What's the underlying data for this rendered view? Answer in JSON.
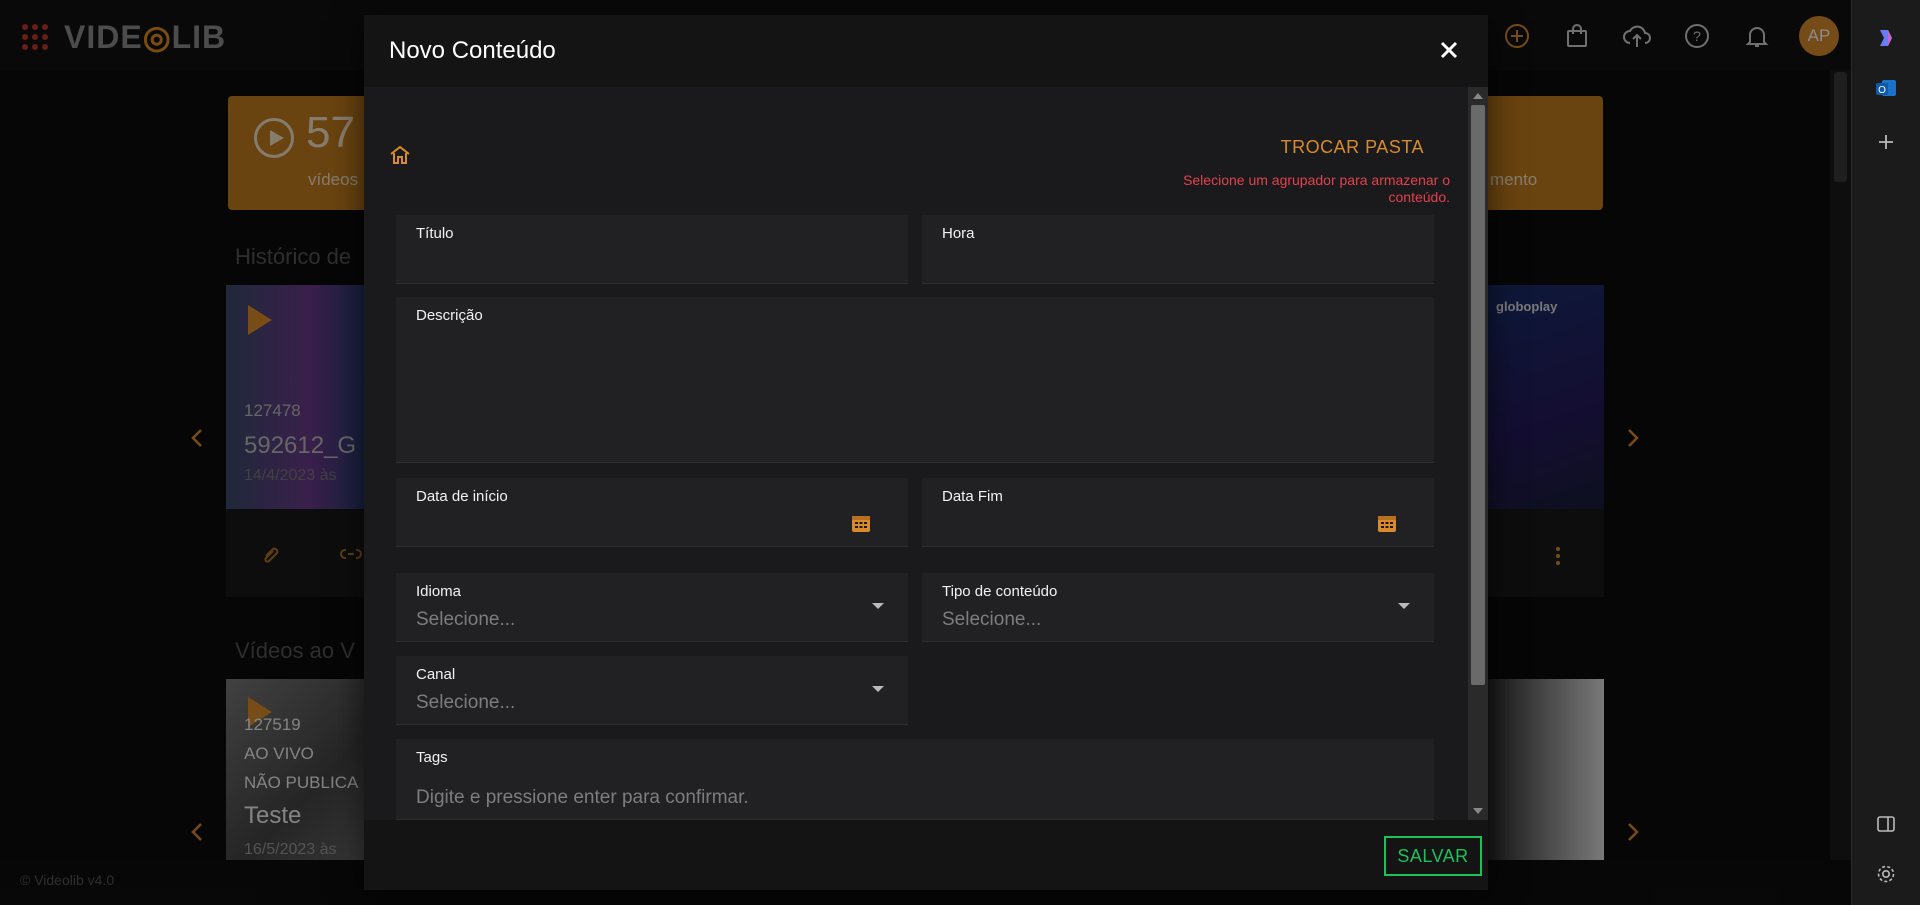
{
  "app": {
    "brand_left": "VIDE",
    "brand_right": "LIB",
    "avatar_initials": "AP",
    "footer_text": "© Videolib v4.0"
  },
  "background": {
    "stat_left": {
      "value": "57",
      "label": "vídeos"
    },
    "stat_right": {
      "label": "mento"
    },
    "section_history": "Histórico de",
    "section_live": "Vídeos ao V",
    "card1": {
      "id": "127478",
      "title": "592612_G",
      "date": "14/4/2023 às"
    },
    "card2": {
      "id": "127519",
      "line2": "AO VIVO",
      "line3": "NÃO PUBLICA",
      "title": "Teste",
      "date": "16/5/2023 às"
    },
    "card_right_brand": "globoplay"
  },
  "modal": {
    "title": "Novo Conteúdo",
    "change_folder": "TROCAR PASTA",
    "hint": "Selecione um agrupador para armazenar o conteúdo.",
    "save": "SALVAR",
    "fields": {
      "titulo": {
        "label": "Título",
        "value": ""
      },
      "hora": {
        "label": "Hora",
        "value": ""
      },
      "descricao": {
        "label": "Descrição",
        "value": ""
      },
      "data_inicio": {
        "label": "Data de início",
        "value": ""
      },
      "data_fim": {
        "label": "Data Fim",
        "value": ""
      },
      "idioma": {
        "label": "Idioma",
        "placeholder": "Selecione..."
      },
      "tipo": {
        "label": "Tipo de conteúdo",
        "placeholder": "Selecione..."
      },
      "canal": {
        "label": "Canal",
        "placeholder": "Selecione..."
      },
      "tags": {
        "label": "Tags",
        "placeholder": "Digite e pressione enter para confirmar."
      }
    }
  },
  "colors": {
    "accent": "#d98b2b",
    "hint_red": "#e0424f",
    "save_green": "#1fbf5a"
  }
}
